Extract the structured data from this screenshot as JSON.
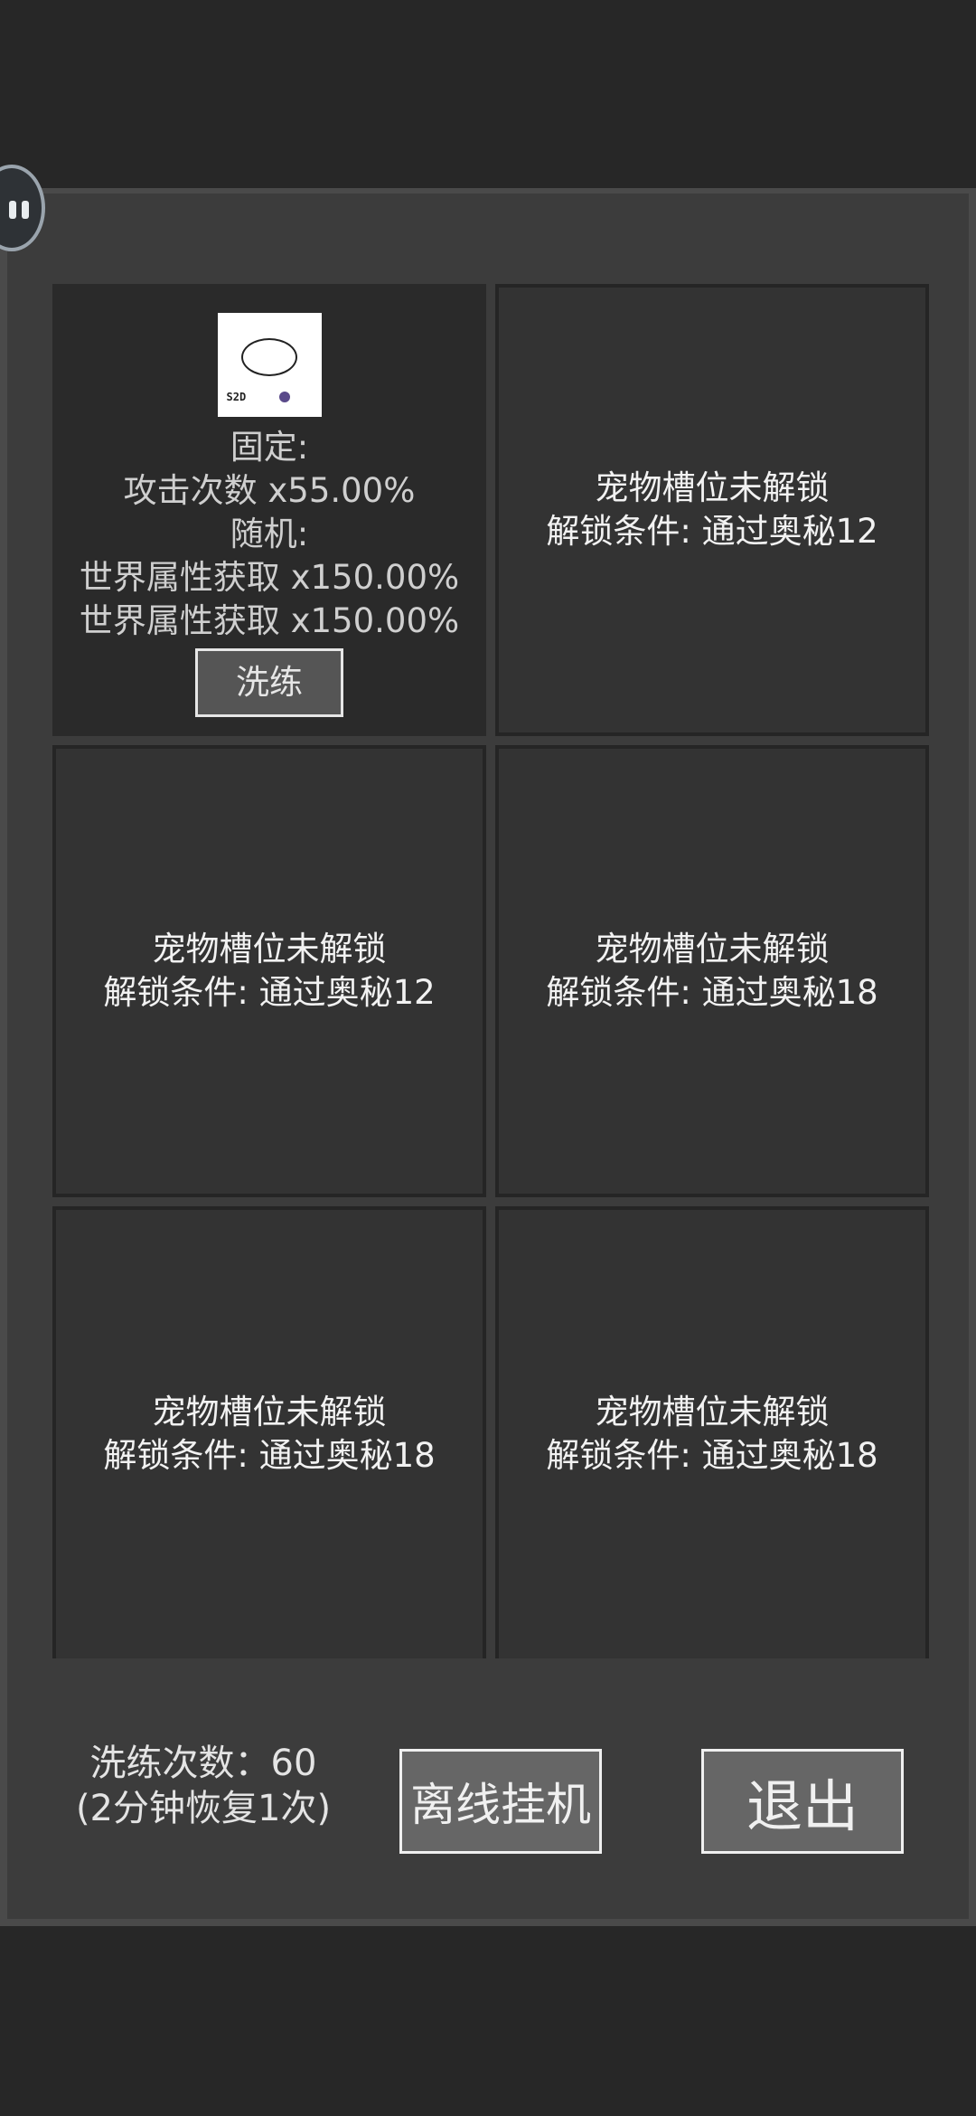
{
  "slots": [
    {
      "fixed_label": "固定:",
      "fixed_value": "攻击次数 x55.00%",
      "random_label": "随机:",
      "random_values": [
        "世界属性获取 x150.00%",
        "世界属性获取 x150.00%"
      ],
      "refine_label": "洗练",
      "pet_mark": "S2D"
    },
    {
      "title": "宠物槽位未解锁",
      "condition": "解锁条件: 通过奥秘12"
    },
    {
      "title": "宠物槽位未解锁",
      "condition": "解锁条件: 通过奥秘12"
    },
    {
      "title": "宠物槽位未解锁",
      "condition": "解锁条件: 通过奥秘18"
    },
    {
      "title": "宠物槽位未解锁",
      "condition": "解锁条件: 通过奥秘18"
    },
    {
      "title": "宠物槽位未解锁",
      "condition": "解锁条件: 通过奥秘18"
    }
  ],
  "footer": {
    "refine_count": "洗练次数：60",
    "recovery": "(2分钟恢复1次)",
    "offline_label": "离线挂机",
    "exit_label": "退出"
  },
  "icons": {
    "floating": "assistant-bubble-icon"
  },
  "colors": {
    "background": "#272727",
    "panel": "#3c3c3c",
    "slot": "#333333",
    "button": "#666666"
  }
}
